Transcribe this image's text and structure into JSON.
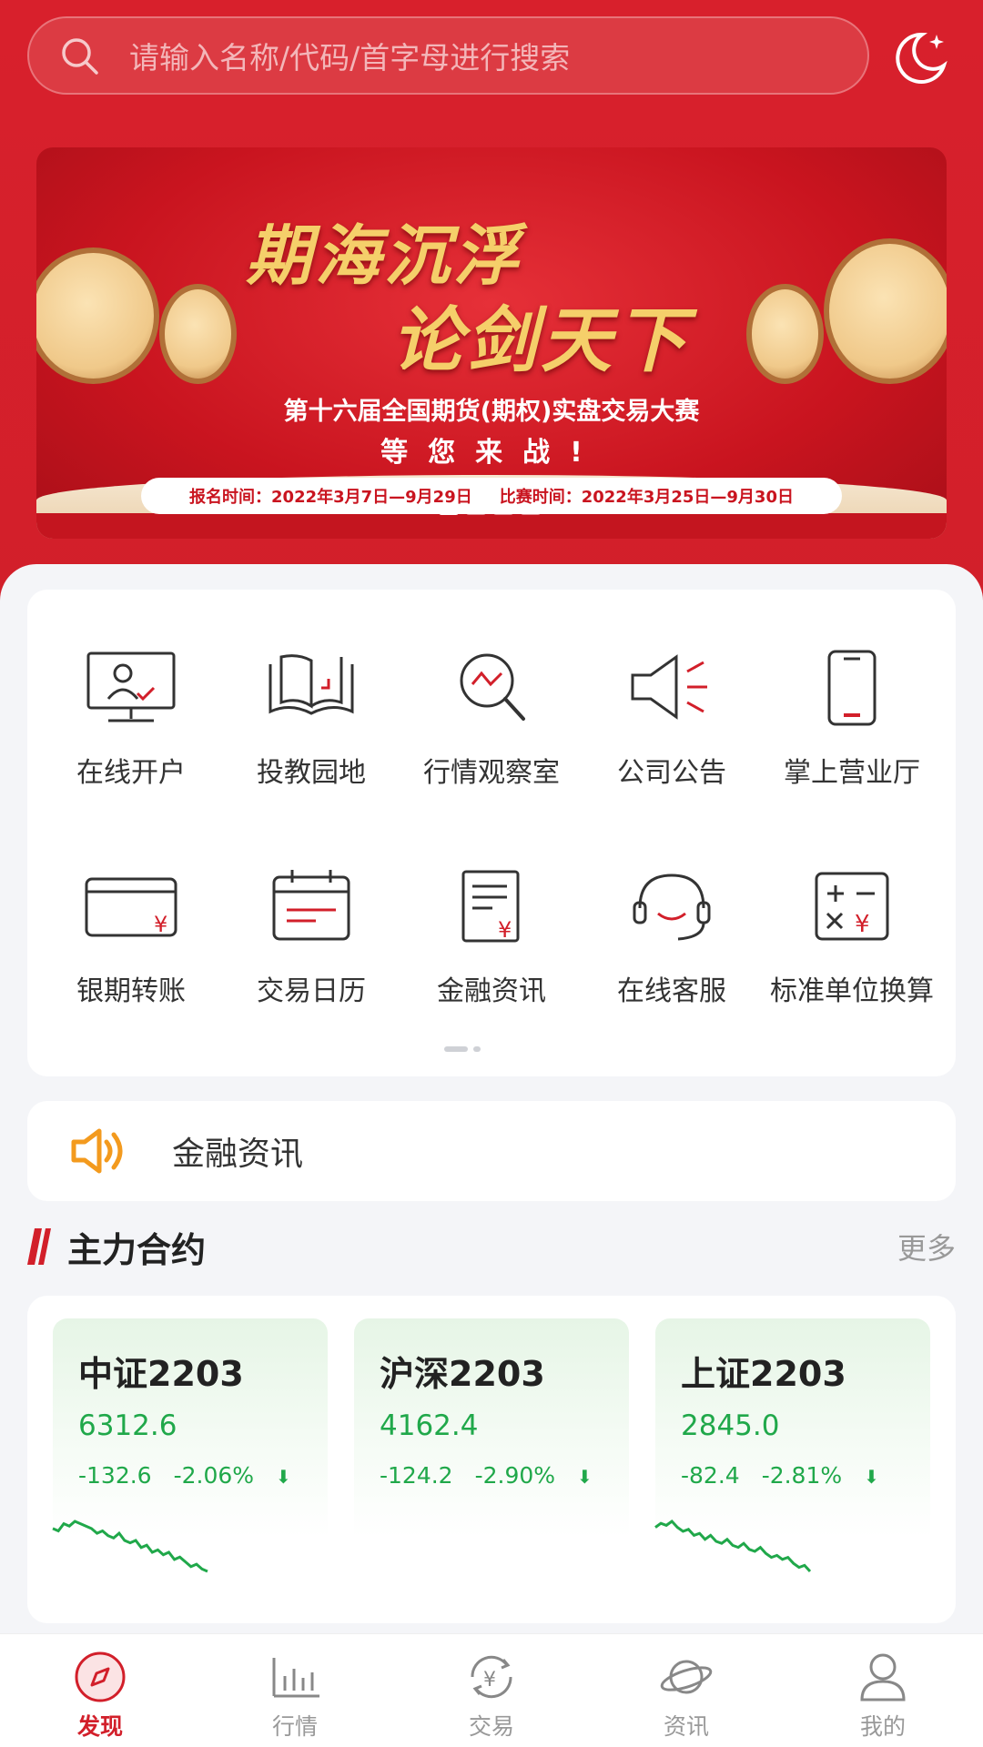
{
  "search": {
    "placeholder": "请输入名称/代码/首字母进行搜索"
  },
  "banner": {
    "title_line1": "期海沉浮",
    "title_line2": "论剑天下",
    "subtitle": "第十六届全国期货(期权)实盘交易大赛",
    "call": "等您来战!",
    "signup_time": "报名时间：2022年3月7日—9月29日",
    "match_time": "比赛时间：2022年3月25日—9月30日"
  },
  "menu": {
    "items": [
      {
        "label": "在线开户",
        "icon": "online-account-icon"
      },
      {
        "label": "投教园地",
        "icon": "education-book-icon"
      },
      {
        "label": "行情观察室",
        "icon": "market-magnifier-icon"
      },
      {
        "label": "公司公告",
        "icon": "announcement-speaker-icon"
      },
      {
        "label": "掌上营业厅",
        "icon": "mobile-phone-icon"
      },
      {
        "label": "银期转账",
        "icon": "bank-transfer-card-icon"
      },
      {
        "label": "交易日历",
        "icon": "calendar-icon"
      },
      {
        "label": "金融资讯",
        "icon": "finance-news-icon"
      },
      {
        "label": "在线客服",
        "icon": "headset-icon"
      },
      {
        "label": "标准单位换算",
        "icon": "calculator-icon"
      }
    ]
  },
  "notice": {
    "text": "金融资讯"
  },
  "section": {
    "title": "主力合约",
    "more": "更多"
  },
  "contracts": [
    {
      "name": "中证2203",
      "price": "6312.6",
      "change": "-132.6",
      "pct": "-2.06%",
      "arrow": "⬇",
      "spark": [
        68,
        67,
        70,
        69,
        71,
        70,
        69,
        68,
        66,
        67,
        65,
        64,
        66,
        63,
        62,
        63,
        60,
        61,
        58,
        59,
        57,
        58,
        55,
        56,
        54,
        52,
        53,
        51,
        50
      ]
    },
    {
      "name": "沪深2203",
      "price": "4162.4",
      "change": "-124.2",
      "pct": "-2.90%",
      "arrow": "⬇",
      "spark": []
    },
    {
      "name": "上证2203",
      "price": "2845.0",
      "change": "-82.4",
      "pct": "-2.81%",
      "arrow": "⬇",
      "spark": [
        70,
        72,
        71,
        73,
        70,
        68,
        69,
        66,
        67,
        64,
        66,
        63,
        62,
        64,
        61,
        60,
        62,
        59,
        58,
        60,
        57,
        55,
        56,
        54,
        55,
        52,
        50,
        51,
        48
      ]
    }
  ],
  "tabs": [
    {
      "label": "发现",
      "icon": "discover-compass-icon",
      "active": true
    },
    {
      "label": "行情",
      "icon": "market-bars-icon",
      "active": false
    },
    {
      "label": "交易",
      "icon": "trade-yuan-icon",
      "active": false
    },
    {
      "label": "资讯",
      "icon": "news-planet-icon",
      "active": false
    },
    {
      "label": "我的",
      "icon": "profile-person-icon",
      "active": false
    }
  ],
  "colors": {
    "brand_red": "#d21f2a",
    "up_down_green": "#20a84a",
    "notice_orange": "#f39a1e"
  }
}
